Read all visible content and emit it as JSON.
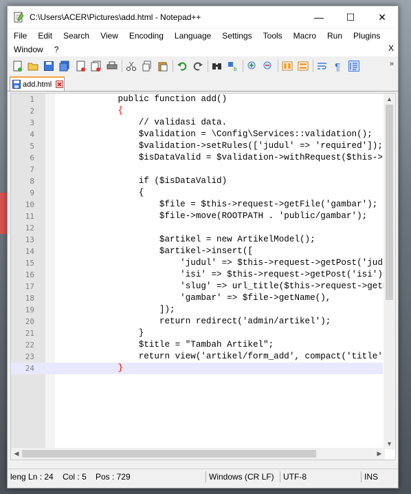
{
  "window": {
    "title": "C:\\Users\\ACER\\Pictures\\add.html - Notepad++",
    "minimize": "—",
    "maximize": "☐",
    "close": "✕"
  },
  "menu": {
    "row1": [
      "File",
      "Edit",
      "Search",
      "View",
      "Encoding",
      "Language",
      "Settings",
      "Tools",
      "Macro",
      "Run",
      "Plugins"
    ],
    "row2": [
      "Window",
      "?"
    ],
    "close_doc": "X"
  },
  "toolbar": {
    "buttons": [
      "new-file-icon",
      "open-file-icon",
      "save-icon",
      "save-all-icon",
      "close-icon",
      "close-all-icon",
      "print-icon",
      "cut-icon",
      "copy-icon",
      "paste-icon",
      "undo-icon",
      "redo-icon",
      "find-icon",
      "replace-icon",
      "zoom-in-icon",
      "zoom-out-icon",
      "sync-vertical-icon",
      "sync-horizontal-icon",
      "word-wrap-icon",
      "show-all-chars-icon",
      "indent-guide-icon"
    ],
    "more": "»"
  },
  "tab": {
    "label": "add.html"
  },
  "editor": {
    "lines": [
      {
        "n": "1",
        "text": "        public function add()"
      },
      {
        "n": "2",
        "text": "        {",
        "brace": true
      },
      {
        "n": "3",
        "text": "            // validasi data."
      },
      {
        "n": "4",
        "text": "            $validation = \\Config\\Services::validation();"
      },
      {
        "n": "5",
        "text": "            $validation->setRules(['judul' => 'required']);"
      },
      {
        "n": "6",
        "text": "            $isDataValid = $validation->withRequest($this->reque"
      },
      {
        "n": "7",
        "text": ""
      },
      {
        "n": "8",
        "text": "            if ($isDataValid)"
      },
      {
        "n": "9",
        "text": "            {"
      },
      {
        "n": "10",
        "text": "                $file = $this->request->getFile('gambar');"
      },
      {
        "n": "11",
        "text": "                $file->move(ROOTPATH . 'public/gambar');"
      },
      {
        "n": "12",
        "text": ""
      },
      {
        "n": "13",
        "text": "                $artikel = new ArtikelModel();"
      },
      {
        "n": "14",
        "text": "                $artikel->insert(["
      },
      {
        "n": "15",
        "text": "                    'judul' => $this->request->getPost('judul'),"
      },
      {
        "n": "16",
        "text": "                    'isi' => $this->request->getPost('isi'),"
      },
      {
        "n": "17",
        "text": "                    'slug' => url_title($this->request->getPost("
      },
      {
        "n": "18",
        "text": "                    'gambar' => $file->getName(),"
      },
      {
        "n": "19",
        "text": "                ]);"
      },
      {
        "n": "20",
        "text": "                return redirect('admin/artikel');"
      },
      {
        "n": "21",
        "text": "            }"
      },
      {
        "n": "22",
        "text": "            $title = \"Tambah Artikel\";"
      },
      {
        "n": "23",
        "text": "            return view('artikel/form_add', compact('title'));"
      },
      {
        "n": "24",
        "text": "        }",
        "brace": true,
        "current": true
      }
    ]
  },
  "status": {
    "lang": "leng",
    "ln": "Ln : 24",
    "col": "Col : 5",
    "pos": "Pos : 729",
    "eol": "Windows (CR LF)",
    "encoding": "UTF-8",
    "mode": "INS"
  },
  "colors": {
    "accent": "#f6a23a",
    "brace": "#ff0000",
    "current_line": "#e8e8ff"
  }
}
